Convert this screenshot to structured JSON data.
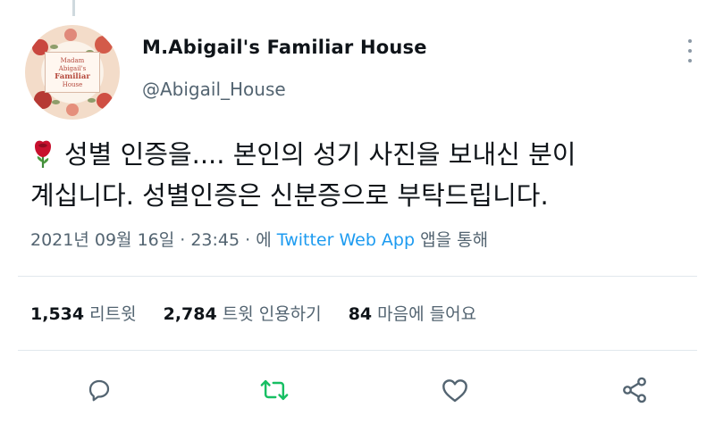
{
  "author": {
    "display_name": "M.Abigail's Familiar House",
    "handle": "@Abigail_House",
    "avatar_lettering": [
      "Madam",
      "Abigail's",
      "Familiar",
      "House"
    ]
  },
  "tweet": {
    "emoji": "rose-emoji",
    "lines": [
      "성별 인증을.... 본인의 성기 사진을 보내신 분이",
      "계십니다. 성별인증은 신분증으로 부탁드립니다."
    ]
  },
  "meta": {
    "datetime": "2021년 09월 16일 · 23:45 · 에",
    "app": "Twitter Web App",
    "app_suffix": "앱을 통해"
  },
  "stats": [
    {
      "count": "1,534",
      "label": "리트윗"
    },
    {
      "count": "2,784",
      "label": "트윗 인용하기"
    },
    {
      "count": "84",
      "label": "마음에 들어요"
    }
  ],
  "actions": {
    "icons": [
      "reply-icon",
      "retweet-icon",
      "like-icon",
      "share-icon"
    ],
    "retweet_color": "#17bf63",
    "default_color": "#536471"
  },
  "colors": {
    "link": "#1d9bf0",
    "secondary_text": "#536471"
  }
}
